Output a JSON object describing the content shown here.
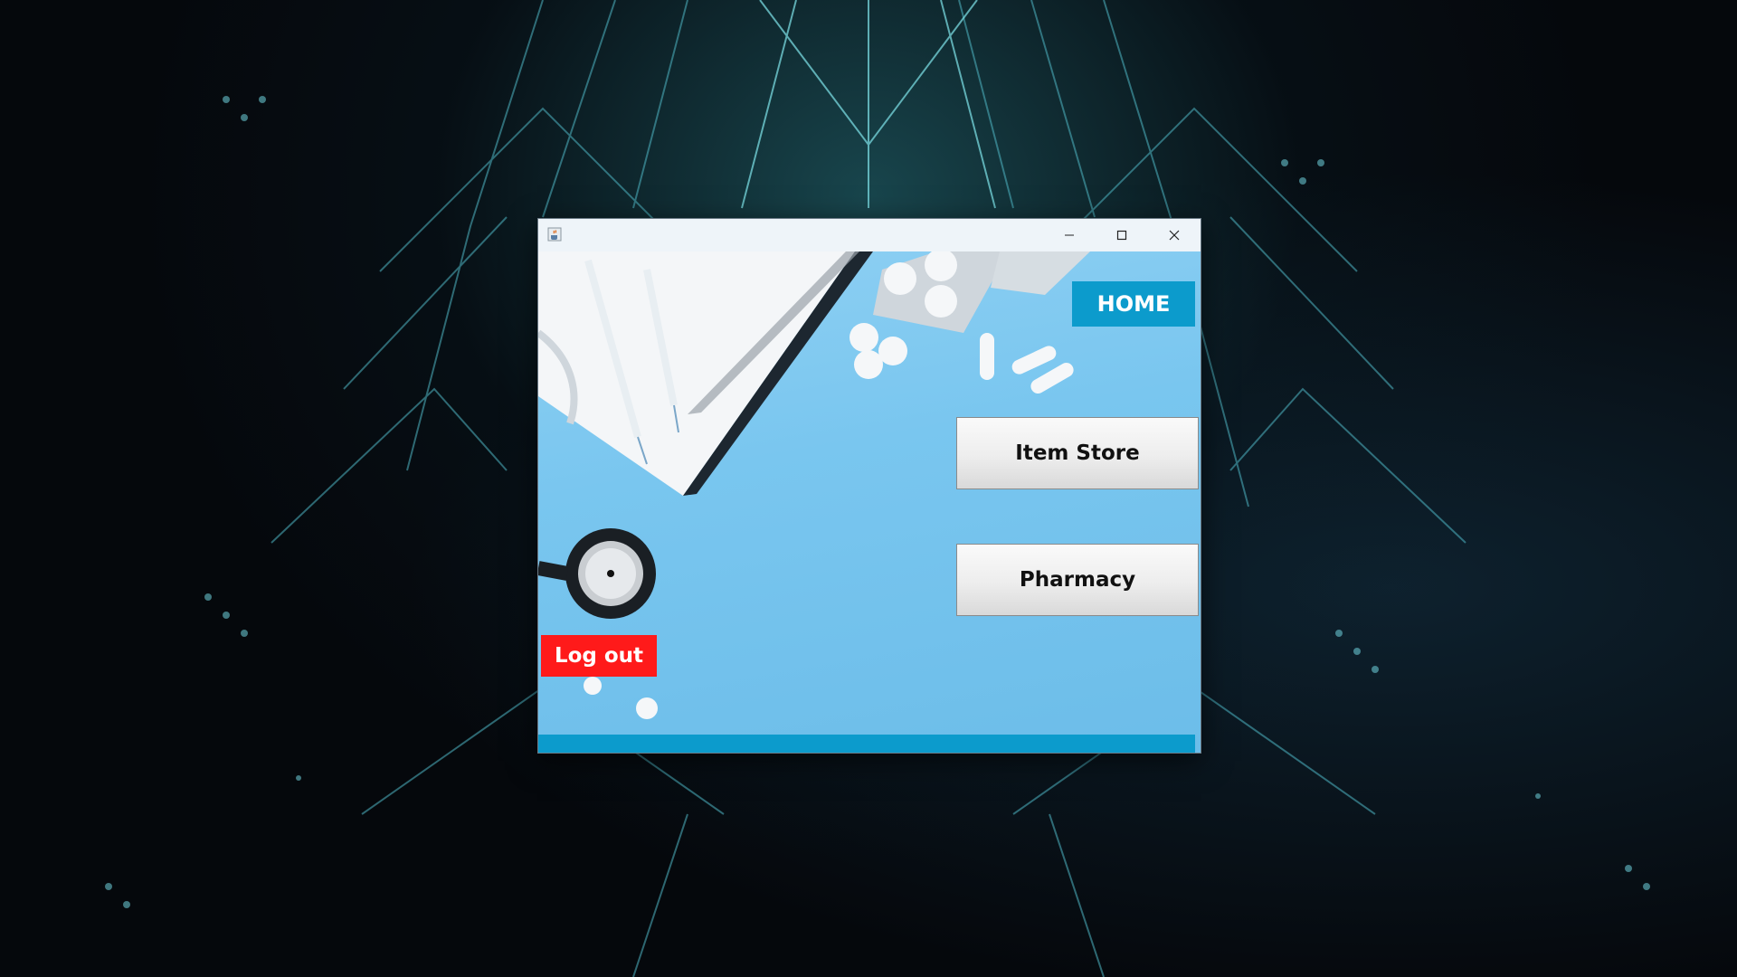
{
  "window": {
    "icon": "java-coffee-cup-icon",
    "controls": [
      "minimize-icon",
      "maximize-icon",
      "close-icon"
    ]
  },
  "home": {
    "title": "HOME"
  },
  "menu": {
    "item_store_label": "Item Store",
    "pharmacy_label": "Pharmacy",
    "logout_label": "Log out"
  },
  "colors": {
    "accent_blue": "#0c9bcc",
    "logout_red": "#ff1a1a",
    "background_blue": "#79c6ef"
  }
}
